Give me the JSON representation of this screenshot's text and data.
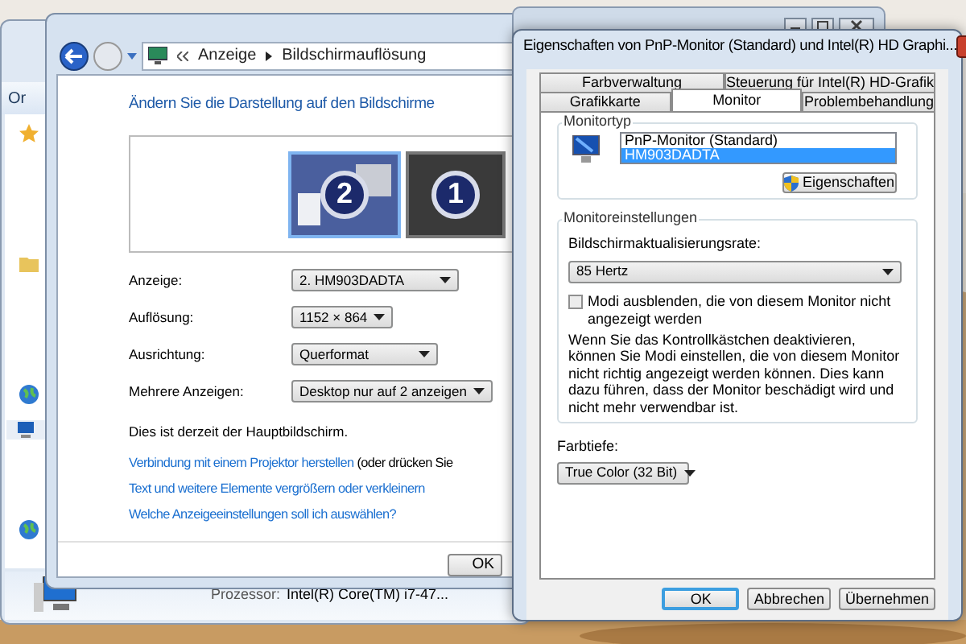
{
  "back_window": {
    "toolbar_text": "Or",
    "processor_label": "Prozessor:",
    "processor_value": "Intel(R) Core(TM) i7-47..."
  },
  "display_window": {
    "breadcrumb": [
      "Anzeige",
      "Bildschirmauflösung"
    ],
    "heading": "Ändern Sie die Darstellung auf den Bildschirme",
    "monitors": [
      {
        "number": "2",
        "selected": true
      },
      {
        "number": "1",
        "selected": false
      }
    ],
    "settings": [
      {
        "label": "Anzeige:",
        "value": "2. HM903DADTA"
      },
      {
        "label": "Auflösung:",
        "value": "1152 × 864"
      },
      {
        "label": "Ausrichtung:",
        "value": "Querformat"
      },
      {
        "label": "Mehrere Anzeigen:",
        "value": "Desktop nur auf 2 anzeigen"
      }
    ],
    "status": "Dies ist derzeit der Hauptbildschirm.",
    "links": [
      {
        "text": "Verbindung mit einem Projektor herstellen",
        "suffix": "(oder drücken Sie"
      },
      {
        "text": "Text und weitere Elemente vergrößern oder verkleinern"
      },
      {
        "text": "Welche Anzeigeeinstellungen soll ich auswählen?"
      }
    ],
    "buttons": [
      "OK"
    ]
  },
  "properties_dialog": {
    "title": "Eigenschaften von PnP-Monitor (Standard) und Intel(R) HD Graphi...",
    "tab_rows": [
      [
        {
          "label": "Farbverwaltung",
          "selected": false
        },
        {
          "label": "Steuerung für Intel(R) HD-Grafik",
          "selected": false
        }
      ],
      [
        {
          "label": "Grafikkarte",
          "selected": false
        },
        {
          "label": "Monitor",
          "selected": true
        },
        {
          "label": "Problembehandlung",
          "selected": false
        }
      ]
    ],
    "monitor_type": {
      "legend": "Monitortyp",
      "items": [
        {
          "label": "PnP-Monitor (Standard)",
          "selected": false
        },
        {
          "label": "HM903DADTA",
          "selected": true
        }
      ],
      "button": "Eigenschaften"
    },
    "monitor_settings": {
      "legend": "Monitoreinstellungen",
      "refresh_label": "Bildschirmaktualisierungsrate:",
      "refresh_value": "85 Hertz",
      "hide_modes": {
        "label": "Modi ausblenden, die von diesem Monitor nicht angezeigt werden",
        "checked": false
      },
      "warning": "Wenn Sie das Kontrollkästchen deaktivieren, können Sie Modi einstellen, die von diesem Monitor nicht richtig angezeigt werden können. Dies kann dazu führen, dass der Monitor beschädigt wird und nicht mehr verwendbar ist."
    },
    "color_depth": {
      "label": "Farbtiefe:",
      "value": "True Color (32 Bit)"
    },
    "buttons": [
      {
        "label": "OK",
        "default": true
      },
      {
        "label": "Abbrechen",
        "default": false
      },
      {
        "label": "Übernehmen",
        "default": false
      }
    ]
  }
}
